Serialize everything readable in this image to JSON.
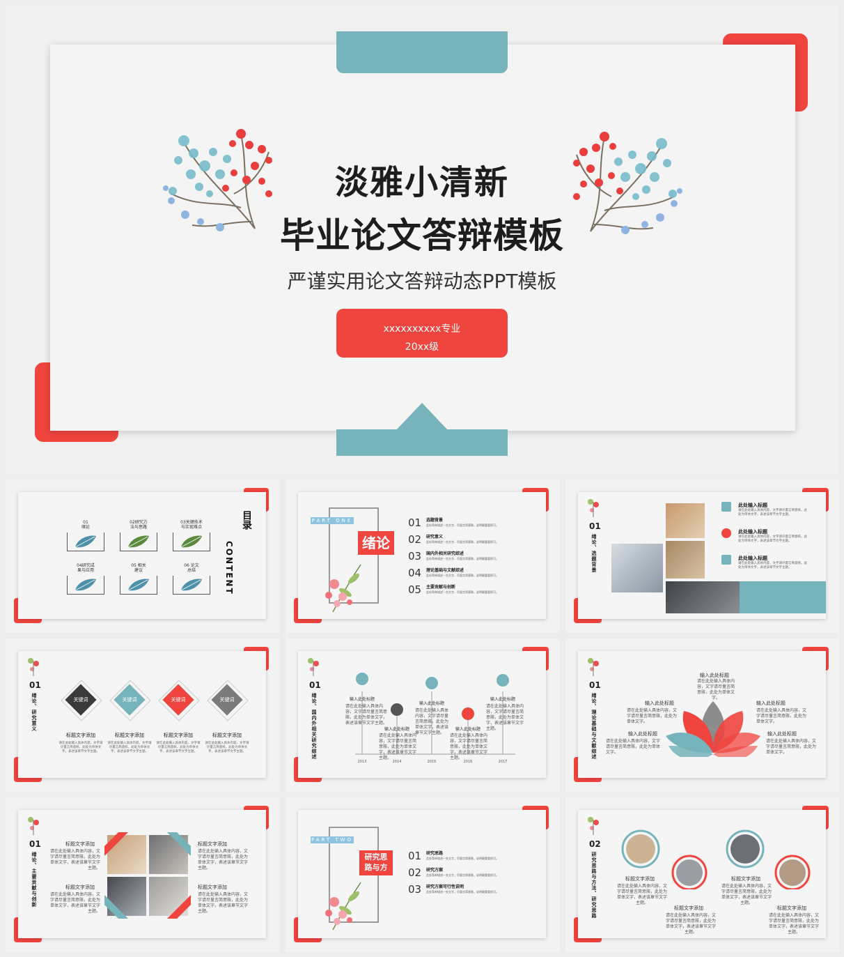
{
  "hero": {
    "title_line1": "淡雅小清新",
    "title_line2": "毕业论文答辩模板",
    "subtitle": "严谨实用论文答辩动态PPT模板",
    "major": "xxxxxxxxxx专业",
    "grade": "20xx级"
  },
  "colors": {
    "teal": "#76b3bb",
    "red": "#f0443f",
    "dark": "#1d1d1d"
  },
  "toc": {
    "title_cn": "目录",
    "title_en": "CONTENT",
    "items": [
      "01\n绪论",
      "02研究方\n法与思路",
      "03关键技术\n与实现难点",
      "04研究成\n果与应用",
      "05 相关\n建议",
      "06 论文\n总结"
    ]
  },
  "part_one": {
    "tag": "PART ONE",
    "label": "绪论",
    "items": [
      {
        "num": "01",
        "title": "选题背景",
        "desc": "此处简单描述一些文字，尽量言简意赅，说明最重要即可。"
      },
      {
        "num": "02",
        "title": "研究意义",
        "desc": "此处简单描述一些文字，尽量言简意赅，说明最重要即可。"
      },
      {
        "num": "03",
        "title": "国内外相关研究综述",
        "desc": "此处简单描述一些文字，尽量言简意赅，说明最重要即可。"
      },
      {
        "num": "04",
        "title": "理论基础与文献综述",
        "desc": "此处简单描述一些文字，尽量言简意赅，说明最重要即可。"
      },
      {
        "num": "05",
        "title": "主要贡献与创新",
        "desc": "此处简单描述一些文字，尽量言简意赅，说明最重要即可。"
      }
    ]
  },
  "slide_bg": {
    "num": "01",
    "vert": "绪论、选题背景",
    "items": [
      {
        "title": "此处输入标题",
        "desc": "请在此处输入具体内容，文字请尽量言简意赅，此处为单体文字，表述该章节文字主题。"
      },
      {
        "title": "此处输入标题",
        "desc": "请在此处输入具体内容，文字请尽量言简意赅，此处为单体文字，表述该章节文字主题。"
      },
      {
        "title": "此处输入标题",
        "desc": "请在此处输入具体内容，文字请尽量言简意赅，此处为单体文字，表述该章节文字主题。"
      }
    ]
  },
  "slide_sig": {
    "num": "01",
    "vert": "绪论、研究意义",
    "keywords": [
      "关键词",
      "关键词",
      "关键词",
      "关键词"
    ],
    "titles": [
      "标题文字添加",
      "标题文字添加",
      "标题文字添加",
      "标题文字添加"
    ],
    "desc": "请在此处输入具体内容，文字请尽量言简意赅，此处为单体文字，表述该章节文字主题。"
  },
  "slide_timeline": {
    "num": "01",
    "vert": "绪论、国内外相关研究综述",
    "top_labels": [
      "输入此处标题",
      "输入此处标题",
      "输入此处标题"
    ],
    "bottom_labels": [
      "输入此处标题",
      "输入此处标题"
    ],
    "years": [
      "2013",
      "2014",
      "2015",
      "2016",
      "2017"
    ],
    "desc": "请在此处输入具体内容，文字请尽量言简意赅，此处为单体文字，表述该章节文字主题。"
  },
  "slide_lotus": {
    "num": "01",
    "vert": "绪论、理论基础与文献综述",
    "top": "输入此处标题",
    "left1": "输入此处标题",
    "right1": "输入此处标题",
    "left2": "输入此处标题",
    "right2": "输入此处标题",
    "desc": "请在此处输入具体内容，文字请尽量言简意赅，此处为单体文字。"
  },
  "slide_contrib": {
    "num": "01",
    "vert": "绪论、主要贡献与创新",
    "titles": [
      "标题文字添加",
      "标题文字添加",
      "标题文字添加",
      "标题文字添加"
    ],
    "desc": "请在此处输入具体内容，文字请尽量言简意赅，此处为单体文字，表述该章节文字主题。"
  },
  "part_two": {
    "tag": "PART TWO",
    "label_line1": "研究思",
    "label_line2": "路与方",
    "items": [
      {
        "num": "01",
        "title": "研究思路",
        "desc": "此处简单描述一些文字，尽量言简意赅，说明最重要即可。"
      },
      {
        "num": "02",
        "title": "研究方案",
        "desc": "此处简单描述一些文字，尽量言简意赅，说明最重要即可。"
      },
      {
        "num": "03",
        "title": "研究方案可行性说明",
        "desc": "此处简单描述一些文字，尽量言简意赅，说明最重要即可。"
      }
    ]
  },
  "slide_method": {
    "num": "02",
    "vert": "研究思路与方法、研究思路",
    "titles": [
      "标题文字添加",
      "标题文字添加",
      "标题文字添加",
      "标题文字添加"
    ],
    "desc": "请在此处输入具体内容，文字请尽量言简意赅，此处为单体文字，表述该章节文字主题。"
  }
}
